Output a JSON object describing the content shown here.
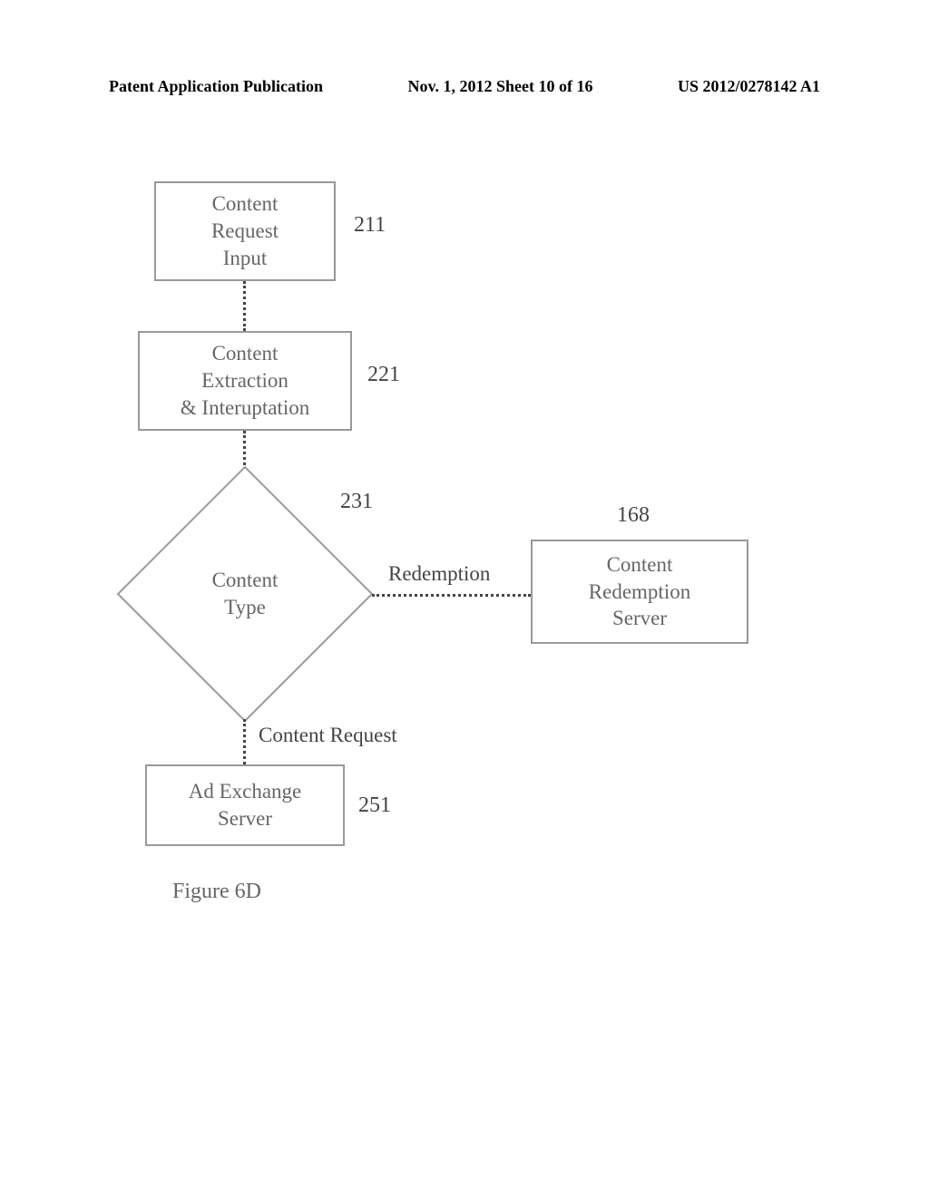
{
  "header": {
    "left": "Patent Application Publication",
    "center": "Nov. 1, 2012  Sheet 10 of 16",
    "right": "US 2012/0278142 A1"
  },
  "nodes": {
    "box211": {
      "text": "Content\nRequest\nInput",
      "ref": "211"
    },
    "box221": {
      "text": "Content\nExtraction\n& Interuptation",
      "ref": "221"
    },
    "diamond231": {
      "text": "Content\nType",
      "ref": "231"
    },
    "box168": {
      "text": "Content\nRedemption\nServer",
      "ref": "168"
    },
    "box251": {
      "text": "Ad Exchange\nServer",
      "ref": "251"
    }
  },
  "edges": {
    "redemption": "Redemption",
    "contentRequest": "Content Request"
  },
  "figureLabel": "Figure 6D"
}
